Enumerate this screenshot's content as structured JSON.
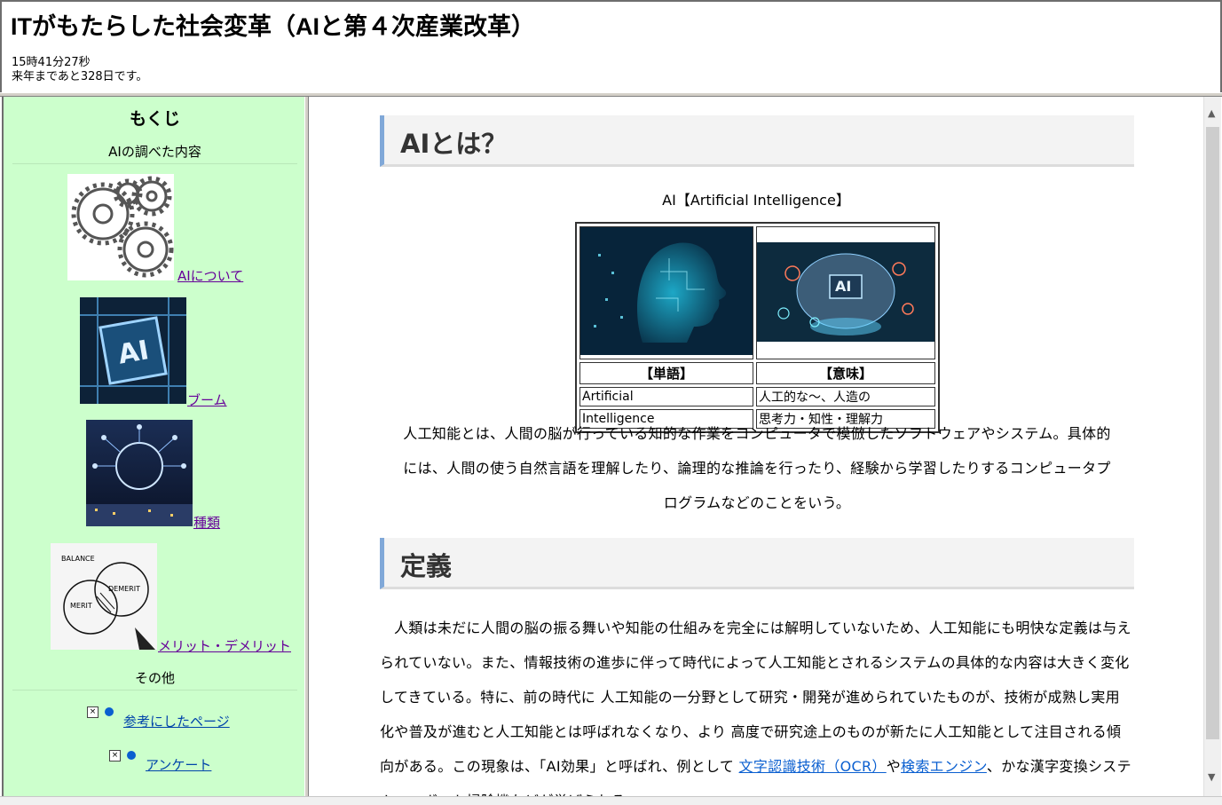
{
  "header": {
    "title": "ITがもたらした社会変革（AIと第４次産業改革）",
    "time": "15時41分27秒",
    "countdown": "来年まであと328日です。"
  },
  "sidebar": {
    "title": "もくじ",
    "section1": "AIの調べた内容",
    "items": [
      {
        "label": "AIについて",
        "icon": "gears-icon"
      },
      {
        "label": "ブーム",
        "icon": "ai-chip-icon"
      },
      {
        "label": "種類",
        "icon": "brain-network-icon"
      },
      {
        "label": "メリット・デメリット",
        "icon": "merit-demerit-diagram-icon"
      }
    ],
    "section2": "その他",
    "extras": [
      {
        "label": "参考にしたページ",
        "icon": "broken-image-icon"
      },
      {
        "label": "アンケート",
        "icon": "broken-image-icon"
      }
    ],
    "diagram_text": {
      "balance": "BALANCE",
      "demerit": "DEMERIT",
      "merit": "MERIT"
    }
  },
  "main": {
    "section1_heading": "AIとは？",
    "ai_caption": "AI【Artificial Intelligence】",
    "table": {
      "headers": [
        "【単語】",
        "【意味】"
      ],
      "rows": [
        [
          "Artificial",
          "人工的な～、人造の"
        ],
        [
          "Intelligence",
          "思考力・知性・理解力"
        ]
      ],
      "image_overlay": "AI"
    },
    "para1": "人工知能とは、人間の脳が行っている知的な作業をコンピュータで模倣したソフトウェアやシステム。具体的には、人間の使う自然言語を理解したり、論理的な推論を行ったり、経験から学習したりするコンピュータプログラムなどのことをいう。",
    "section2_heading": "定義",
    "para2_text": "人類は未だに人間の脳の振る舞いや知能の仕組みを完全には解明していないため、人工知能にも明快な定義は与えられていない。また、情報技術の進歩に伴って時代によって人工知能とされるシステムの具体的な内容は大きく変化してきている。特に、前の時代に 人工知能の一分野として研究・開発が進められていたものが、技術が成熟し実用化や普及が進むと人工知能とは呼ばれなくなり、より 高度で研究途上のものが新たに人工知能として注目される傾向がある。この現象は、「AI効果」と呼ばれ、例として",
    "para2_link1": "文字認識技術（OCR）",
    "para2_mid": "や",
    "para2_link2": "検索エンジン",
    "para2_tail": "、かな漢字変換システム、ロボット掃除機などが挙げられる。"
  },
  "colors": {
    "sidebar_bg": "#ccffcc",
    "visited_link": "#660099",
    "link": "#0a5fd0",
    "heading_accent": "#80a8d8"
  }
}
